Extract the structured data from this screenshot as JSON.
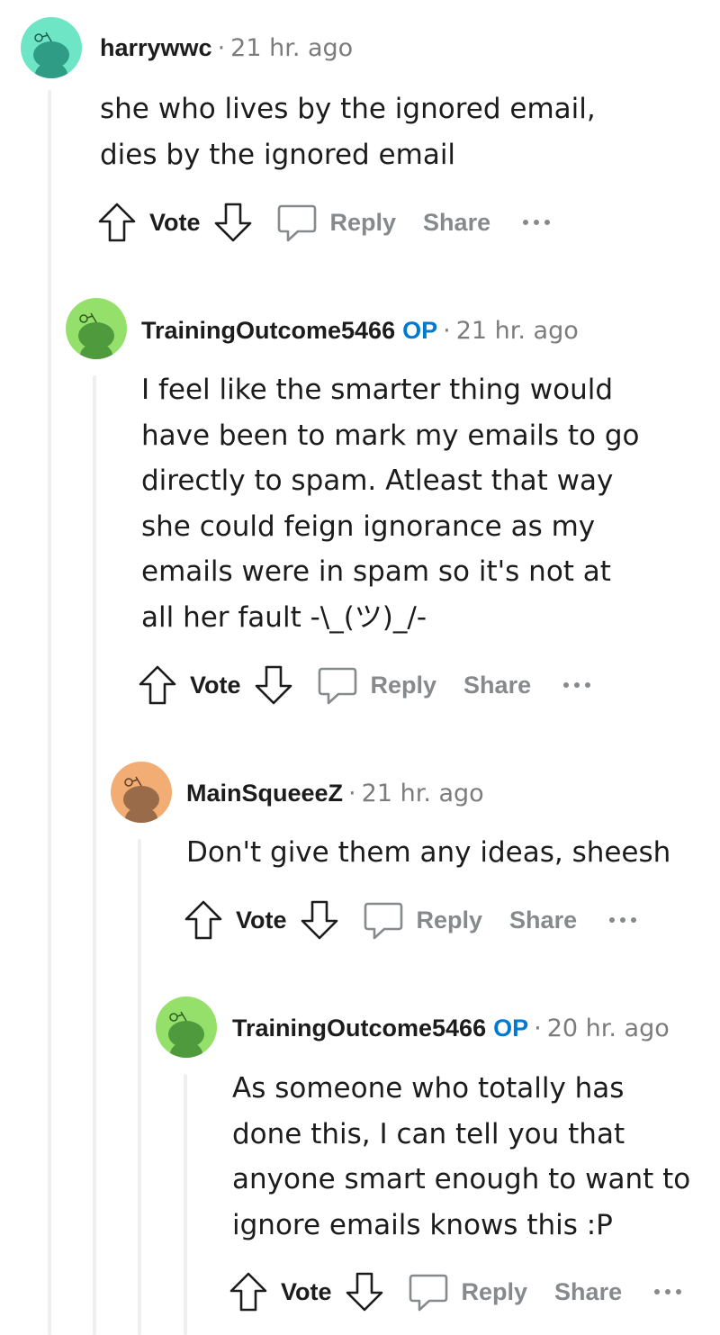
{
  "comments": [
    {
      "author": "harrywwc",
      "op": "",
      "separator": "·",
      "time": "21 hr. ago",
      "avatar_color": "#6ee6c6",
      "avatar_fg": "#2f9c86",
      "body": "she who lives by the ignored email,\ndies by the ignored email",
      "vote_label": "Vote",
      "reply_label": "Reply",
      "share_label": "Share"
    },
    {
      "author": "TrainingOutcome5466",
      "op": "OP",
      "separator": "·",
      "time": "21 hr. ago",
      "avatar_color": "#94e06a",
      "avatar_fg": "#4f9a3d",
      "body": "I feel like the smarter thing would\nhave been to mark my emails to go\ndirectly to spam. Atleast that way\nshe could feign ignorance as my\nemails were in spam so it's not at\nall her fault -\\_(ツ)_/-",
      "vote_label": "Vote",
      "reply_label": "Reply",
      "share_label": "Share"
    },
    {
      "author": "MainSqueeeZ",
      "op": "",
      "separator": "·",
      "time": "21 hr. ago",
      "avatar_color": "#f2ad74",
      "avatar_fg": "#9a6b48",
      "body": "Don't give them any ideas, sheesh",
      "vote_label": "Vote",
      "reply_label": "Reply",
      "share_label": "Share"
    },
    {
      "author": "TrainingOutcome5466",
      "op": "OP",
      "separator": "·",
      "time": "20 hr. ago",
      "avatar_color": "#94e06a",
      "avatar_fg": "#4f9a3d",
      "body": "As someone who totally has\ndone this, I can tell you that\nanyone smart enough to want to\nignore emails knows this :P",
      "vote_label": "Vote",
      "reply_label": "Reply",
      "share_label": "Share"
    }
  ],
  "icons": [
    "upvote-icon",
    "downvote-icon",
    "comment-bubble-icon",
    "more-options-icon",
    "snoo-avatar-icon"
  ],
  "colors": {
    "op_badge": "#0079d3",
    "muted": "#878a8c",
    "thread_line": "#edeff1"
  }
}
